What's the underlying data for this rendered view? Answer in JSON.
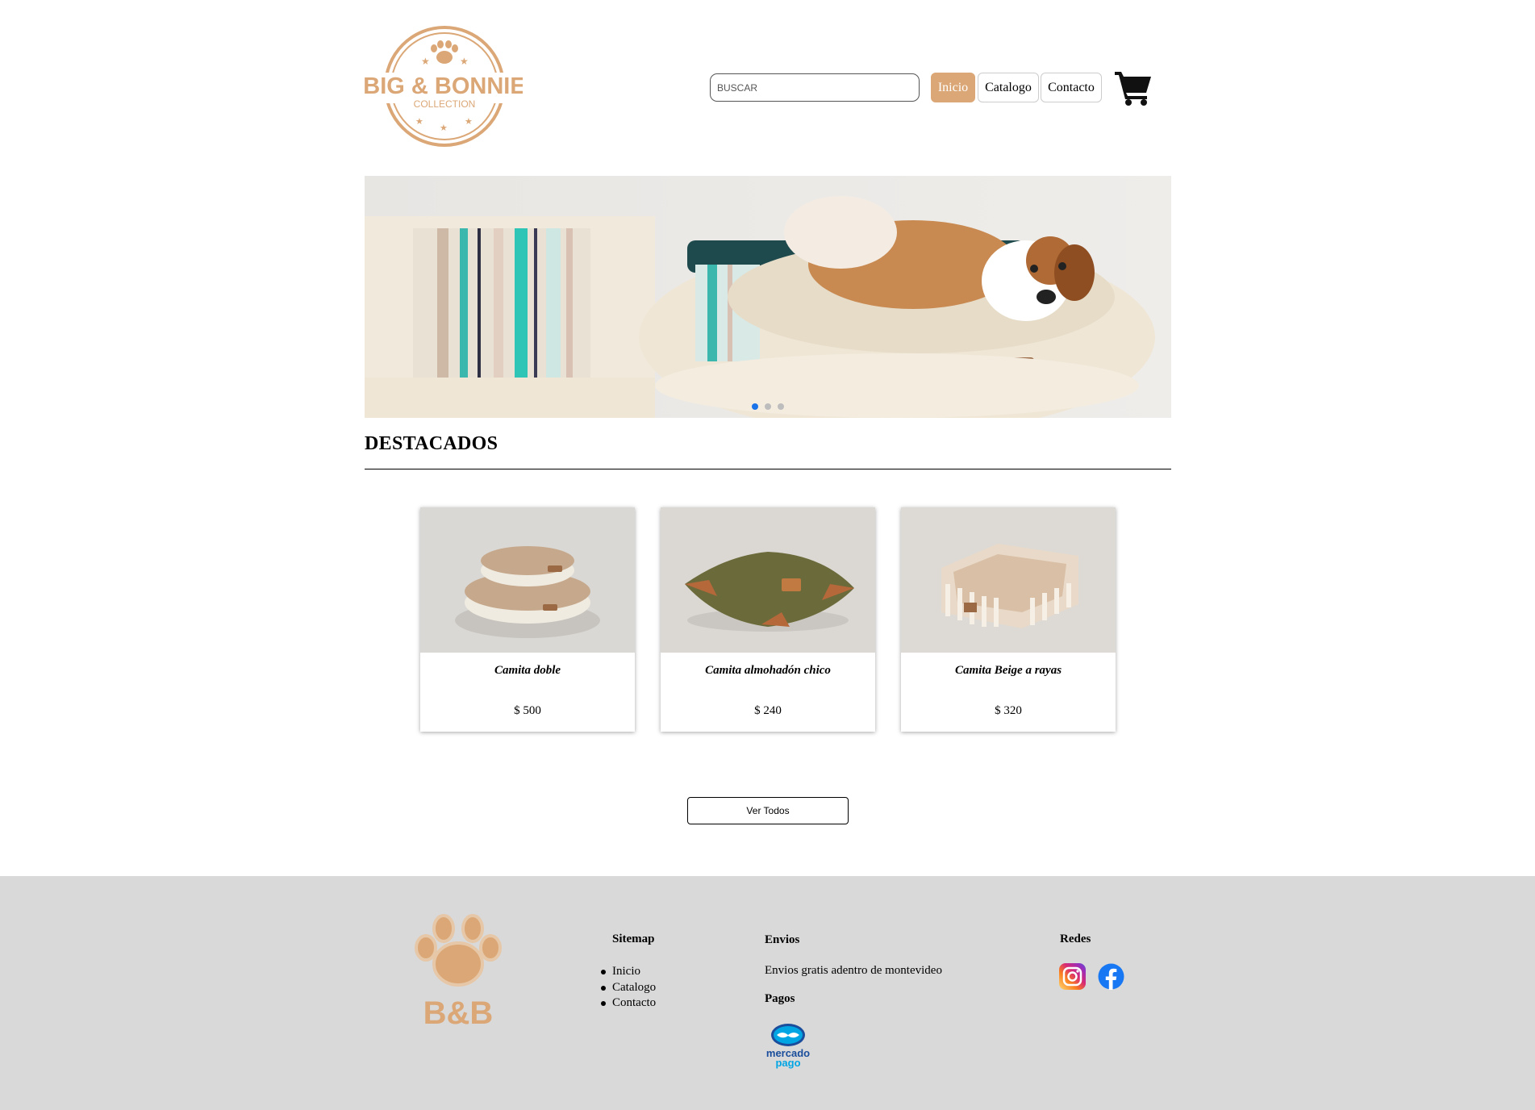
{
  "brand": {
    "logo_text_main": "BIG & BONNIE",
    "logo_text_sub": "COLLECTION",
    "footer_logo_text": "B&B",
    "accent_color": "#dba776"
  },
  "header": {
    "search_placeholder": "BUSCAR",
    "nav": [
      {
        "label": "Inicio",
        "active": true
      },
      {
        "label": "Catalogo",
        "active": false
      },
      {
        "label": "Contacto",
        "active": false
      }
    ],
    "cart_icon": "shopping-cart-icon"
  },
  "hero": {
    "slide_count": 3,
    "active_slide": 1
  },
  "featured": {
    "title": "DESTACADOS",
    "products": [
      {
        "name": "Camita doble",
        "price": "$ 500"
      },
      {
        "name": "Camita almohadón chico",
        "price": "$ 240"
      },
      {
        "name": "Camita Beige a rayas",
        "price": "$ 320"
      }
    ],
    "view_all_label": "Ver Todos"
  },
  "footer": {
    "sitemap": {
      "heading": "Sitemap",
      "links": [
        "Inicio",
        "Catalogo",
        "Contacto"
      ]
    },
    "shipping": {
      "heading": "Envios",
      "text": "Envios gratis adentro de montevideo"
    },
    "payments": {
      "heading": "Pagos",
      "provider_line1": "mercado",
      "provider_line2": "pago"
    },
    "social": {
      "heading": "Redes",
      "icons": [
        "instagram-icon",
        "facebook-icon"
      ]
    },
    "background": "#d9d9d9"
  }
}
